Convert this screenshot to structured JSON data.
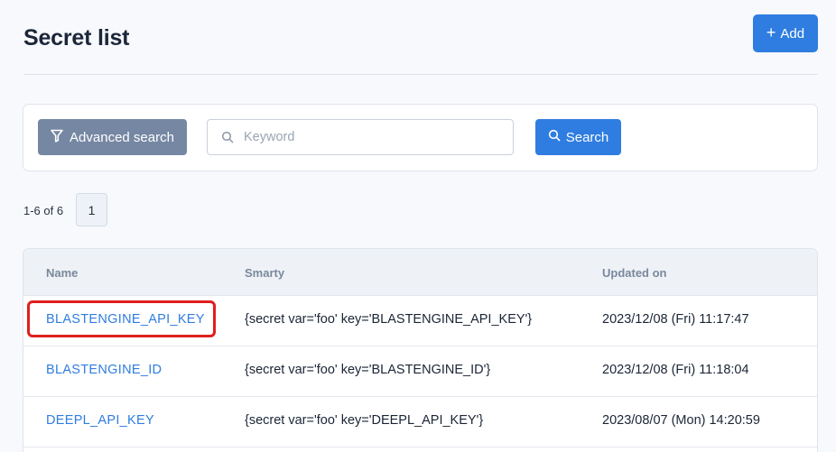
{
  "header": {
    "title": "Secret list",
    "add_label": "Add"
  },
  "search": {
    "advanced_label": "Advanced search",
    "keyword_placeholder": "Keyword",
    "keyword_value": "",
    "search_label": "Search"
  },
  "pagination": {
    "range_text": "1-6 of 6",
    "current_page": "1"
  },
  "table": {
    "columns": [
      "Name",
      "Smarty",
      "Updated on"
    ],
    "rows": [
      {
        "name": "BLASTENGINE_API_KEY",
        "smarty": "{secret var='foo' key='BLASTENGINE_API_KEY'}",
        "updated": "2023/12/08 (Fri) 11:17:47"
      },
      {
        "name": "BLASTENGINE_ID",
        "smarty": "{secret var='foo' key='BLASTENGINE_ID'}",
        "updated": "2023/12/08 (Fri) 11:18:04"
      },
      {
        "name": "DEEPL_API_KEY",
        "smarty": "{secret var='foo' key='DEEPL_API_KEY'}",
        "updated": "2023/08/07 (Mon) 14:20:59"
      }
    ]
  },
  "colors": {
    "primary": "#2f7de1",
    "secondary": "#7587a3",
    "highlight": "#e01e1e"
  },
  "icons": {
    "add": "plus-icon",
    "advanced_search": "filter-icon",
    "keyword": "search-icon",
    "search_button": "search-icon"
  }
}
